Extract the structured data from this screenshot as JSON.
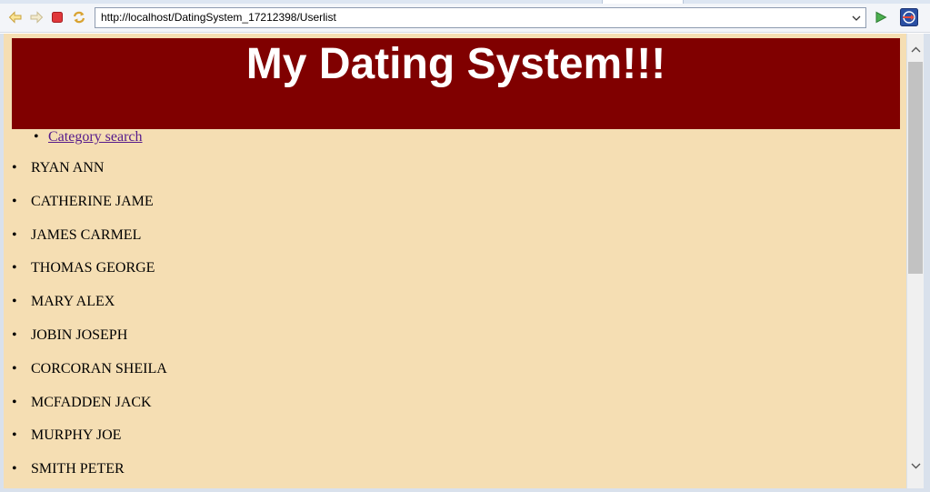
{
  "browser": {
    "url": "http://localhost/DatingSystem_17212398/Userlist",
    "icons": {
      "back": "back-arrow-icon",
      "forward": "forward-arrow-icon",
      "stop": "stop-icon",
      "refresh": "refresh-icon",
      "dropdown": "chevron-down-icon",
      "go": "go-icon",
      "external": "external-browser-icon"
    }
  },
  "page": {
    "title": "My Dating System!!!",
    "nav": {
      "category_search": "Category search"
    },
    "users": [
      "RYAN ANN",
      "CATHERINE JAME",
      "JAMES CARMEL",
      "THOMAS GEORGE",
      "MARY ALEX",
      "JOBIN JOSEPH",
      "CORCORAN SHEILA",
      "MCFADDEN JACK",
      "MURPHY JOE",
      "SMITH PETER"
    ]
  },
  "colors": {
    "banner": "#800000",
    "page_background": "#f5deb3",
    "title_text": "#ffffff",
    "visited_link": "#551a8b"
  }
}
